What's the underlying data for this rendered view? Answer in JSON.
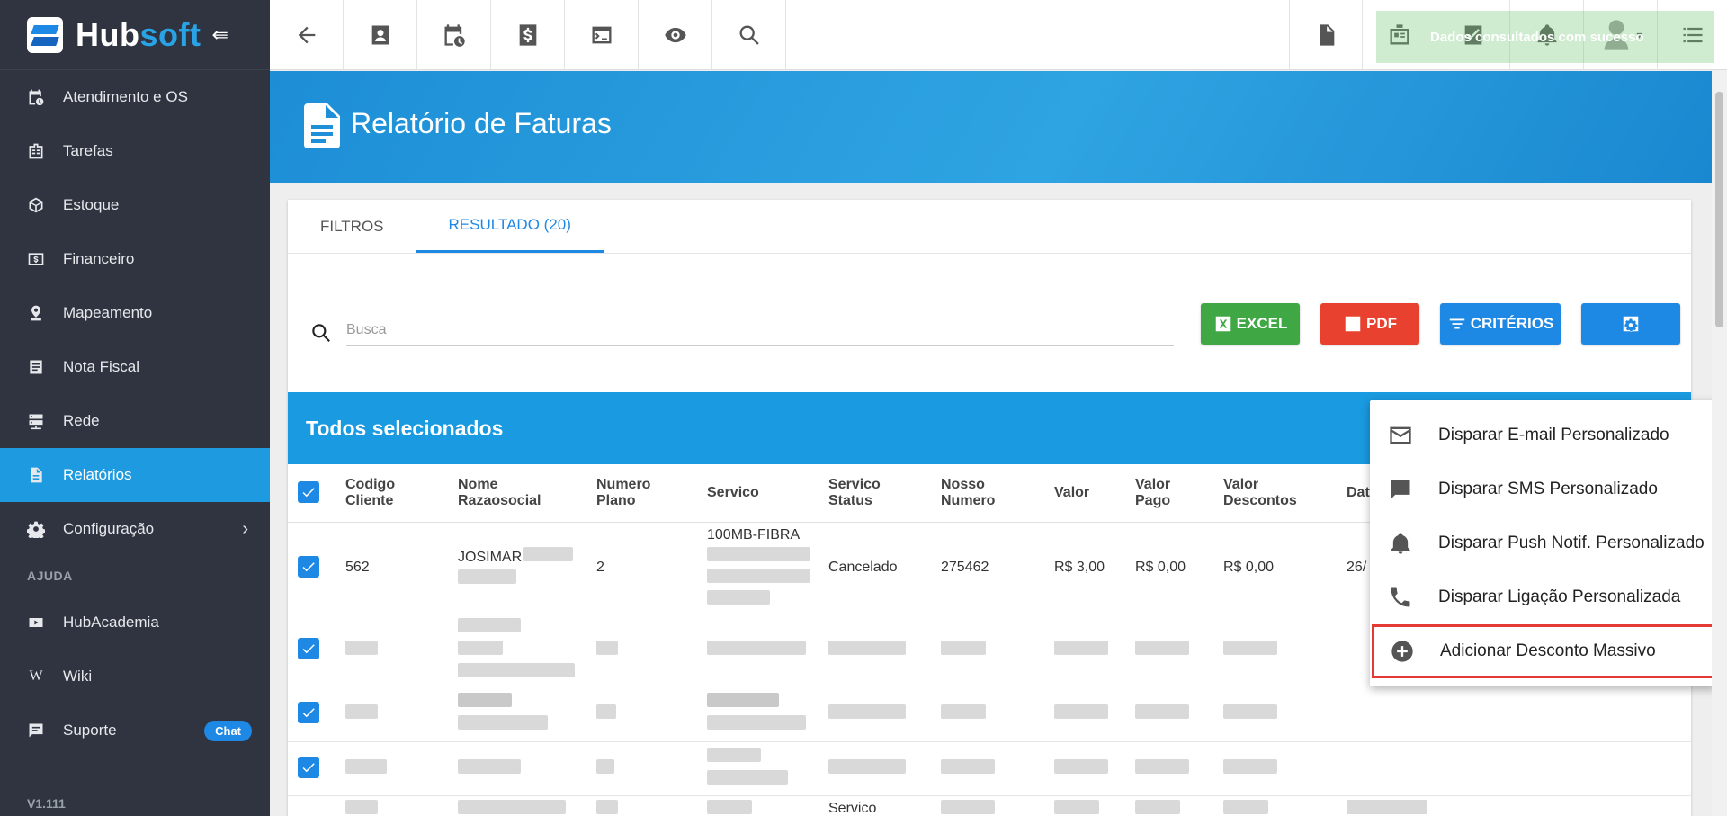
{
  "app": {
    "name_part1": "Hub",
    "name_part2": "soft",
    "version": "V1.111"
  },
  "sidebar": {
    "items": [
      {
        "label": "Atendimento e OS",
        "icon": "calendar-clock-icon"
      },
      {
        "label": "Tarefas",
        "icon": "tasks-icon"
      },
      {
        "label": "Estoque",
        "icon": "box-icon"
      },
      {
        "label": "Financeiro",
        "icon": "money-icon"
      },
      {
        "label": "Mapeamento",
        "icon": "map-pin-icon"
      },
      {
        "label": "Nota Fiscal",
        "icon": "document-icon"
      },
      {
        "label": "Rede",
        "icon": "server-icon"
      },
      {
        "label": "Relatórios",
        "icon": "report-icon",
        "active": true
      },
      {
        "label": "Configuração",
        "icon": "gear-icon"
      }
    ],
    "help_section": "AJUDA",
    "help_items": [
      {
        "label": "HubAcademia",
        "icon": "youtube-icon"
      },
      {
        "label": "Wiki",
        "icon": "wikipedia-icon"
      },
      {
        "label": "Suporte",
        "icon": "chat-icon",
        "badge": "Chat"
      }
    ]
  },
  "topbar": {
    "toast": "Dados consultados com sucesso"
  },
  "page": {
    "title": "Relatório de Faturas"
  },
  "tabs": [
    {
      "label": "FILTROS"
    },
    {
      "label": "RESULTADO (20)"
    }
  ],
  "search": {
    "placeholder": "Busca"
  },
  "buttons": {
    "excel": "EXCEL",
    "pdf": "PDF",
    "criterios": "CRITÉRIOS"
  },
  "selection": {
    "label": "Todos selecionados"
  },
  "table": {
    "headers": [
      "Codigo Cliente",
      "Nome Razaosocial",
      "Numero Plano",
      "Servico",
      "Servico Status",
      "Nosso Numero",
      "Valor",
      "Valor Pago",
      "Valor Descontos",
      "Dat"
    ],
    "row1": {
      "codigo": "562",
      "nome": "JOSIMAR",
      "plano": "2",
      "servico": "100MB-FIBRA",
      "status": "Cancelado",
      "nosso_numero": "275462",
      "valor": "R$ 3,00",
      "valor_pago": "R$ 0,00",
      "valor_descontos": "R$ 0,00",
      "data": "26/"
    },
    "partial_row_status": "Servico"
  },
  "dropdown": {
    "items": [
      {
        "label": "Disparar E-mail Personalizado",
        "icon": "email-icon"
      },
      {
        "label": "Disparar SMS Personalizado",
        "icon": "sms-icon"
      },
      {
        "label": "Disparar Push Notif. Personalizado",
        "icon": "bell-icon"
      },
      {
        "label": "Disparar Ligação Personalizada",
        "icon": "phone-icon"
      },
      {
        "label": "Adicionar Desconto Massivo",
        "icon": "add-circle-icon",
        "highlighted": true
      }
    ]
  },
  "colors": {
    "sidebar": "#2f3440",
    "accent": "#1e9be0",
    "excel": "#3fa845",
    "pdf": "#e8412f",
    "criterios": "#1e88e5",
    "highlight": "#e53935"
  }
}
